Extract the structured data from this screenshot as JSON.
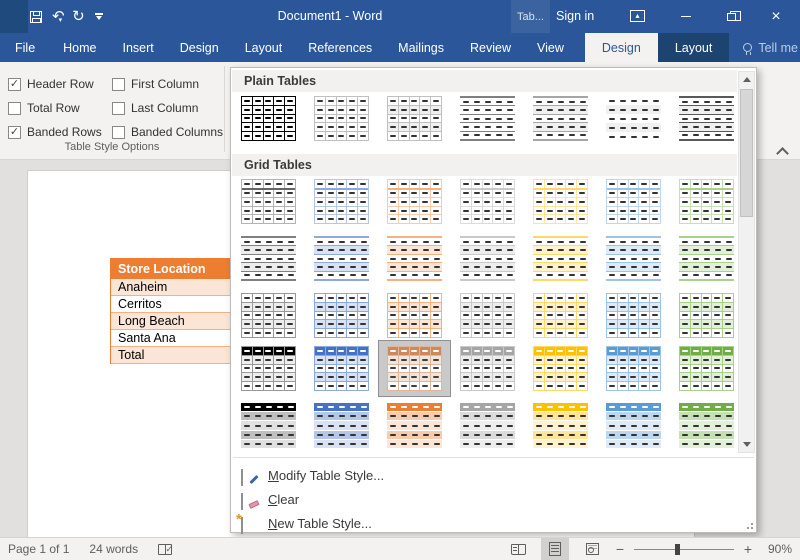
{
  "title_bar": {
    "title": "Document1 - Word",
    "contextual_label": "Tab...",
    "sign_in_label": "Sign in"
  },
  "ribbon": {
    "tabs": [
      "File",
      "Home",
      "Insert",
      "Design",
      "Layout",
      "References",
      "Mailings",
      "Review",
      "View"
    ],
    "contextual_tabs": [
      {
        "label": "Design",
        "selected": true
      },
      {
        "label": "Layout",
        "selected": false
      }
    ],
    "tell_me_label": "Tell me",
    "style_options": {
      "group_label": "Table Style Options",
      "options": [
        {
          "label": "Header Row",
          "checked": true
        },
        {
          "label": "Total Row",
          "checked": false
        },
        {
          "label": "Banded Rows",
          "checked": true
        },
        {
          "label": "First Column",
          "checked": false
        },
        {
          "label": "Last Column",
          "checked": false
        },
        {
          "label": "Banded Columns",
          "checked": false
        }
      ]
    }
  },
  "gallery": {
    "sections": [
      {
        "label": "Plain Tables",
        "rows": [
          [
            {
              "k": "grid",
              "g": "#000000"
            },
            {
              "k": "grid",
              "g": "#c0c0c0"
            },
            {
              "k": "grid",
              "g": "#c0c0c0",
              "b": "#f0f0f0"
            },
            {
              "k": "hl",
              "g": "#7f7f7f"
            },
            {
              "k": "hl",
              "g": "#a6a6a6",
              "b": "#f0f0f0"
            },
            {
              "k": "open",
              "b": "#f0f0f0"
            },
            {
              "k": "hl",
              "g": "#595959",
              "b": "#f0f0f0"
            }
          ]
        ]
      },
      {
        "label": "Grid Tables",
        "rows": [
          [
            {
              "k": "grid",
              "g": "#b3b3b3",
              "hu": "#666666"
            },
            {
              "k": "grid",
              "g": "#b4c7e7",
              "hu": "#8eaadb"
            },
            {
              "k": "grid",
              "g": "#f7cbac",
              "hu": "#f4b183"
            },
            {
              "k": "grid",
              "g": "#dbdbdb",
              "hu": "#c9c9c9"
            },
            {
              "k": "grid",
              "g": "#ffe599",
              "hu": "#ffd966"
            },
            {
              "k": "grid",
              "g": "#bdd7ee",
              "hu": "#9dc3e6"
            },
            {
              "k": "grid",
              "g": "#c5e0b3",
              "hu": "#a9d18e"
            }
          ],
          [
            {
              "k": "hl",
              "g": "#808080",
              "b": "#ededed"
            },
            {
              "k": "hl",
              "g": "#8eaadb",
              "b": "#d9e2f3"
            },
            {
              "k": "hl",
              "g": "#f4b183",
              "b": "#fbe5d6"
            },
            {
              "k": "hl",
              "g": "#c9c9c9",
              "b": "#ededed"
            },
            {
              "k": "hl",
              "g": "#ffd966",
              "b": "#fff2cc"
            },
            {
              "k": "hl",
              "g": "#9dc3e6",
              "b": "#deeaf6"
            },
            {
              "k": "hl",
              "g": "#a9d18e",
              "b": "#e2efd9"
            }
          ],
          [
            {
              "k": "grid",
              "g": "#999999",
              "b": "#ededed"
            },
            {
              "k": "grid",
              "g": "#8eaadb",
              "b": "#d9e2f3"
            },
            {
              "k": "grid",
              "g": "#f4b183",
              "b": "#fbe5d6"
            },
            {
              "k": "grid",
              "g": "#c9c9c9",
              "b": "#ededed"
            },
            {
              "k": "grid",
              "g": "#ffd966",
              "b": "#fff2cc"
            },
            {
              "k": "grid",
              "g": "#9dc3e6",
              "b": "#deeaf6"
            },
            {
              "k": "grid",
              "g": "#a9d18e",
              "b": "#e2efd9"
            }
          ],
          [
            {
              "k": "grid",
              "g": "#999999",
              "b": "#ededed",
              "hb": "#000000"
            },
            {
              "k": "grid",
              "g": "#8eaadb",
              "b": "#d9e2f3",
              "hb": "#4472c4"
            },
            {
              "k": "grid",
              "g": "#f4b183",
              "b": "#fbe5d6",
              "hb": "#ed7d31",
              "selected": true
            },
            {
              "k": "grid",
              "g": "#c9c9c9",
              "b": "#ededed",
              "hb": "#a5a5a5"
            },
            {
              "k": "grid",
              "g": "#ffd966",
              "b": "#fff2cc",
              "hb": "#ffc000"
            },
            {
              "k": "grid",
              "g": "#9dc3e6",
              "b": "#deeaf6",
              "hb": "#5b9bd5"
            },
            {
              "k": "grid",
              "g": "#a9d18e",
              "b": "#e2efd9",
              "hb": "#70ad47"
            }
          ],
          [
            {
              "k": "open",
              "hb": "#000000",
              "b": "#bfbfbf",
              "b2": "#e0e0e0"
            },
            {
              "k": "open",
              "hb": "#4472c4",
              "b": "#b4c7e7",
              "b2": "#d9e2f3"
            },
            {
              "k": "open",
              "hb": "#ed7d31",
              "b": "#f7cbac",
              "b2": "#fbe5d6"
            },
            {
              "k": "open",
              "hb": "#a5a5a5",
              "b": "#dbdbdb",
              "b2": "#ededed"
            },
            {
              "k": "open",
              "hb": "#ffc000",
              "b": "#ffe599",
              "b2": "#fff2cc"
            },
            {
              "k": "open",
              "hb": "#5b9bd5",
              "b": "#bdd7ee",
              "b2": "#deeaf6"
            },
            {
              "k": "open",
              "hb": "#70ad47",
              "b": "#c5e0b3",
              "b2": "#e2efd9"
            }
          ]
        ]
      }
    ],
    "menu": [
      {
        "label": "Modify Table Style...",
        "icon": "modify-table-style-icon"
      },
      {
        "label": "Clear",
        "icon": "clear-icon"
      },
      {
        "label": "New Table Style...",
        "icon": "new-table-style-icon"
      }
    ]
  },
  "document": {
    "table": {
      "header_label": "Store Location",
      "rows": [
        "Anaheim",
        "Cerritos",
        "Long Beach",
        "Santa Ana",
        "Total"
      ]
    }
  },
  "status_bar": {
    "page_label": "Page 1 of 1",
    "word_count_label": "24 words",
    "zoom_percent": "90%"
  },
  "colors": {
    "title_bar": "#2b579a",
    "accent_orange": "#ed7d31",
    "accent_orange_light": "#fbe5d6",
    "ribbon_bg": "#f3f2f1"
  }
}
